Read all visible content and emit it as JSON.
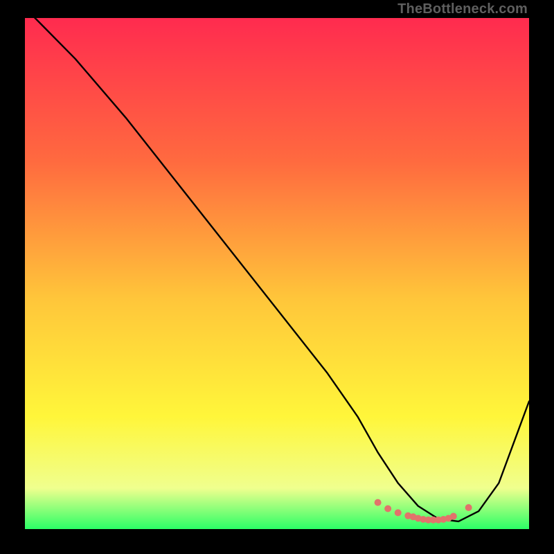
{
  "watermark": "TheBottleneck.com",
  "colors": {
    "frame": "#000000",
    "gradient_top": "#ff2b4f",
    "gradient_mid1": "#ff6a3f",
    "gradient_mid2": "#ffc63a",
    "gradient_mid3": "#fff63a",
    "gradient_mid4": "#f0ff8e",
    "gradient_bottom": "#2bff66",
    "curve": "#000000",
    "dots": "#e2726b"
  },
  "chart_data": {
    "type": "line",
    "title": "",
    "xlabel": "",
    "ylabel": "",
    "xlim": [
      0,
      100
    ],
    "ylim": [
      0,
      100
    ],
    "series": [
      {
        "name": "curve",
        "x": [
          0,
          4,
          10,
          20,
          30,
          40,
          50,
          60,
          66,
          70,
          74,
          78,
          82,
          86,
          90,
          94,
          100
        ],
        "y": [
          102,
          98,
          92,
          80.5,
          68,
          55.5,
          43,
          30.5,
          22,
          15,
          9,
          4.5,
          2,
          1.5,
          3.5,
          9,
          25
        ]
      }
    ],
    "dots": {
      "name": "optimal-range",
      "x": [
        70,
        72,
        74,
        76,
        77,
        78,
        79,
        80,
        81,
        82,
        83,
        84,
        85,
        88
      ],
      "y": [
        5.2,
        4.0,
        3.2,
        2.6,
        2.4,
        2.1,
        1.9,
        1.8,
        1.8,
        1.8,
        1.9,
        2.1,
        2.5,
        4.2
      ]
    }
  }
}
